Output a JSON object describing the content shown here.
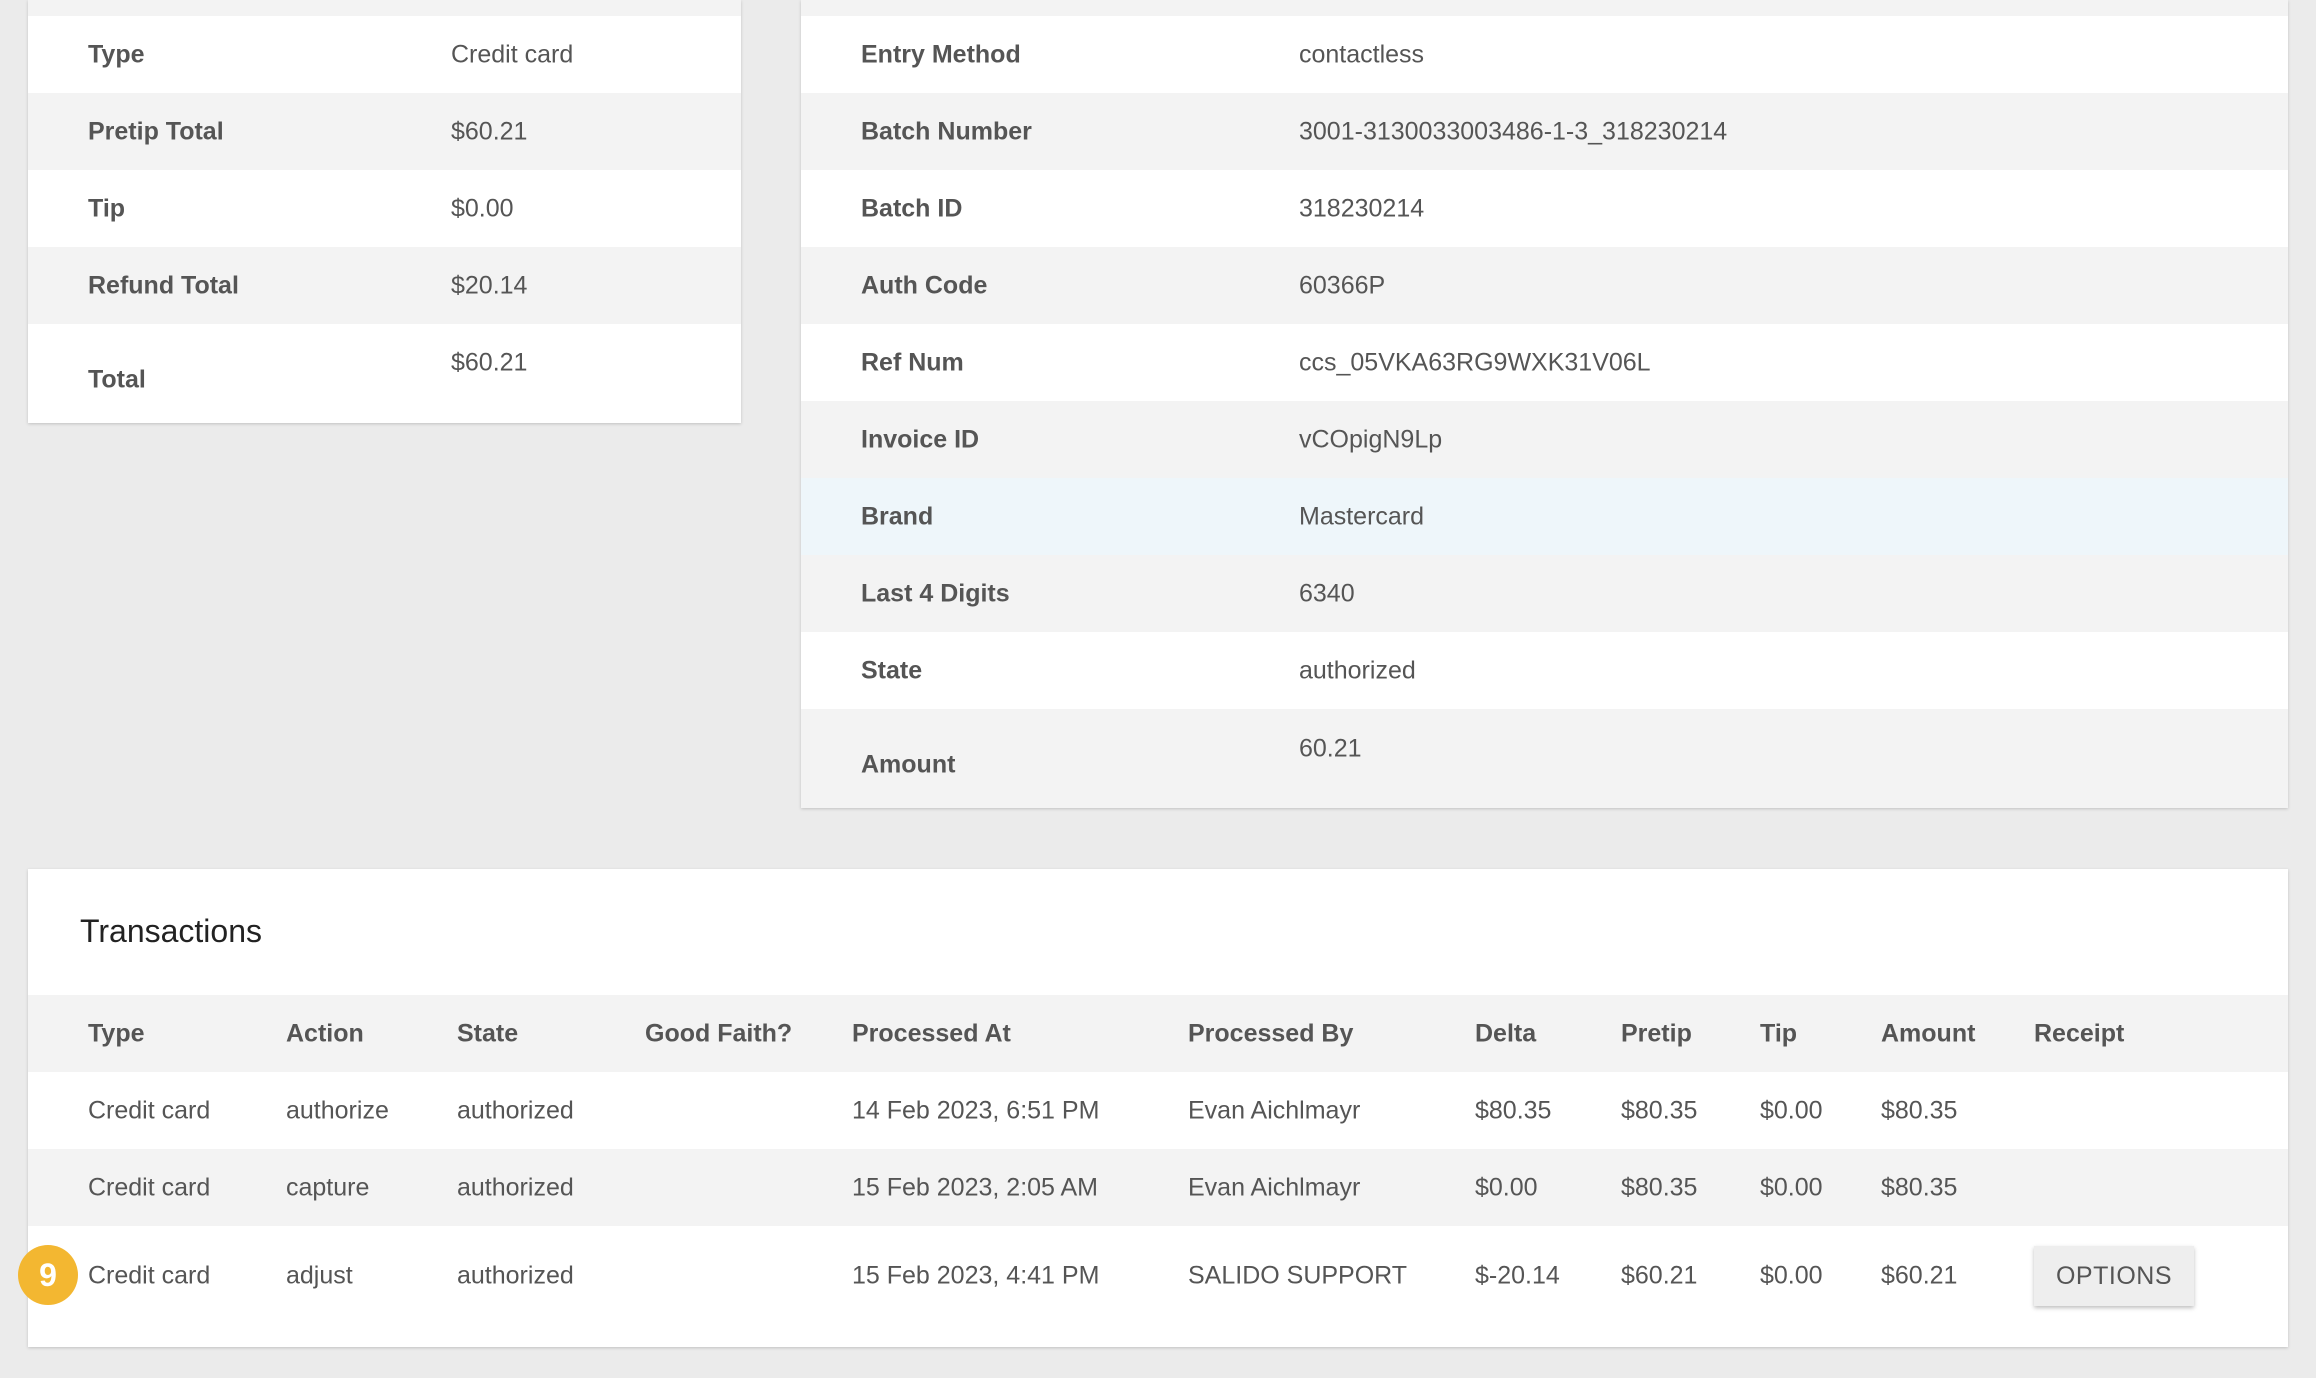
{
  "summary": {
    "rows": [
      {
        "label": "Type",
        "value": "Credit card"
      },
      {
        "label": "Pretip Total",
        "value": "$60.21"
      },
      {
        "label": "Tip",
        "value": "$0.00"
      },
      {
        "label": "Refund Total",
        "value": "$20.14"
      },
      {
        "label": "Total",
        "value": "$60.21"
      }
    ]
  },
  "details": {
    "rows": [
      {
        "label": "Entry Method",
        "value": "contactless"
      },
      {
        "label": "Batch Number",
        "value": "3001-3130033003486-1-3_318230214"
      },
      {
        "label": "Batch ID",
        "value": "318230214"
      },
      {
        "label": "Auth Code",
        "value": "60366P"
      },
      {
        "label": "Ref Num",
        "value": "ccs_05VKA63RG9WXK31V06L"
      },
      {
        "label": "Invoice ID",
        "value": "vCOpigN9Lp"
      },
      {
        "label": "Brand",
        "value": "Mastercard"
      },
      {
        "label": "Last 4 Digits",
        "value": "6340"
      },
      {
        "label": "State",
        "value": "authorized"
      },
      {
        "label": "Amount",
        "value": "60.21"
      }
    ]
  },
  "transactions": {
    "title": "Transactions",
    "columns": [
      "Type",
      "Action",
      "State",
      "Good Faith?",
      "Processed At",
      "Processed By",
      "Delta",
      "Pretip",
      "Tip",
      "Amount",
      "Receipt"
    ],
    "rows": [
      {
        "type": "Credit card",
        "action": "authorize",
        "state": "authorized",
        "good_faith": "",
        "processed_at": "14 Feb 2023, 6:51 PM",
        "processed_by": "Evan Aichlmayr",
        "delta": "$80.35",
        "pretip": "$80.35",
        "tip": "$0.00",
        "amount": "$80.35"
      },
      {
        "type": "Credit card",
        "action": "capture",
        "state": "authorized",
        "good_faith": "",
        "processed_at": "15 Feb 2023, 2:05 AM",
        "processed_by": "Evan Aichlmayr",
        "delta": "$0.00",
        "pretip": "$80.35",
        "tip": "$0.00",
        "amount": "$80.35"
      },
      {
        "type": "Credit card",
        "action": "adjust",
        "state": "authorized",
        "good_faith": "",
        "processed_at": "15 Feb 2023, 4:41 PM",
        "processed_by": "SALIDO SUPPORT",
        "delta": "$-20.14",
        "pretip": "$60.21",
        "tip": "$0.00",
        "amount": "$60.21",
        "receipt_button": "OPTIONS"
      }
    ]
  },
  "badge": {
    "number": "9",
    "color": "#f3b731"
  },
  "colors": {
    "page_bg": "#ebebeb",
    "row_alt": "#f3f3f3",
    "row_highlight": "#eef6fa"
  }
}
